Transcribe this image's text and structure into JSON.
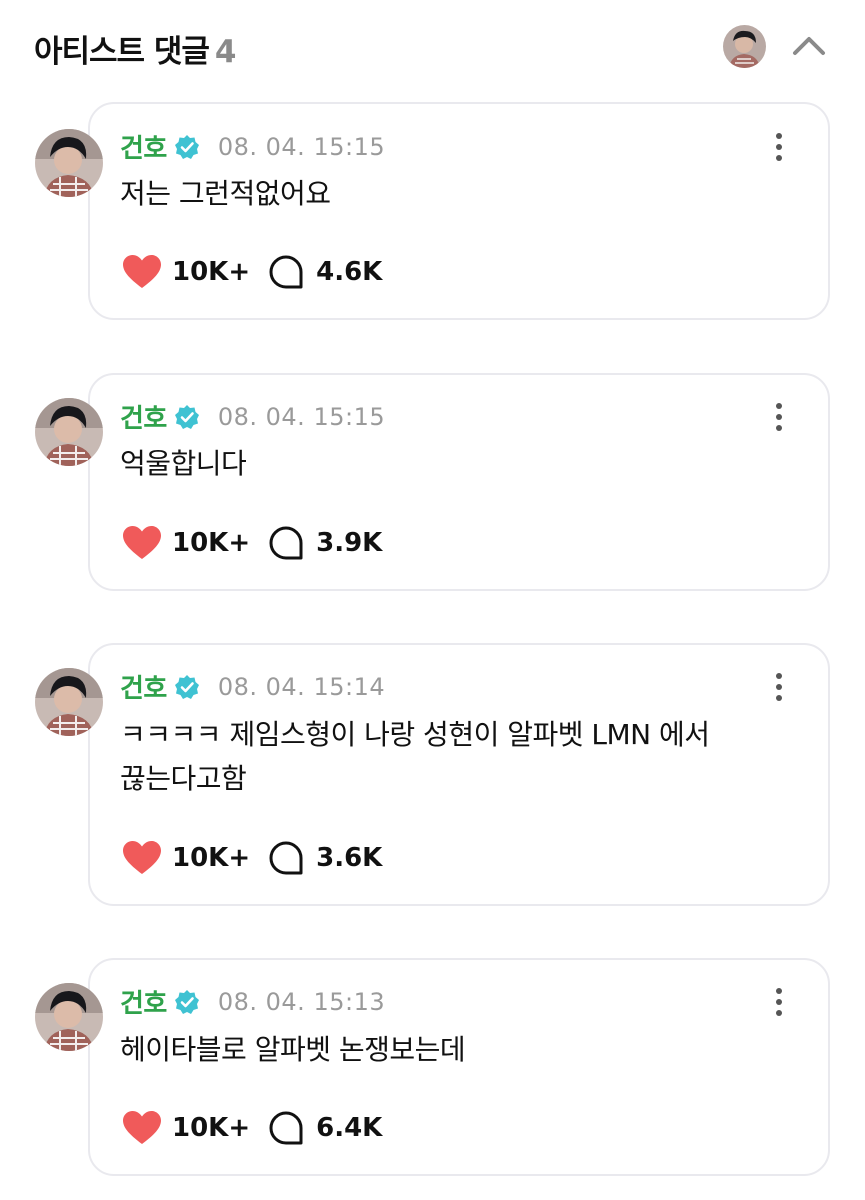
{
  "header": {
    "title": "아티스트 댓글",
    "count": "4"
  },
  "colors": {
    "author": "#2fa24b",
    "verified": "#3fc2d2",
    "like": "#f05a5a",
    "timestamp": "#9a9a9a"
  },
  "icons": {
    "verified": "verified-badge-icon",
    "like": "heart-icon",
    "reply": "speech-bubble-icon",
    "more": "more-vertical-icon",
    "collapse": "chevron-up-icon"
  },
  "comments": [
    {
      "author": "건호",
      "timestamp": "08. 04. 15:15",
      "text": "저는 그런적없어요",
      "likes": "10K+",
      "replies": "4.6K"
    },
    {
      "author": "건호",
      "timestamp": "08. 04. 15:15",
      "text": "억울합니다",
      "likes": "10K+",
      "replies": "3.9K"
    },
    {
      "author": "건호",
      "timestamp": "08. 04. 15:14",
      "text": "ㅋㅋㅋㅋ 제임스형이 나랑 성현이 알파벳 LMN 에서 끊는다고함",
      "likes": "10K+",
      "replies": "3.6K"
    },
    {
      "author": "건호",
      "timestamp": "08. 04. 15:13",
      "text": "헤이타블로 알파벳 논쟁보는데",
      "likes": "10K+",
      "replies": "6.4K"
    }
  ]
}
